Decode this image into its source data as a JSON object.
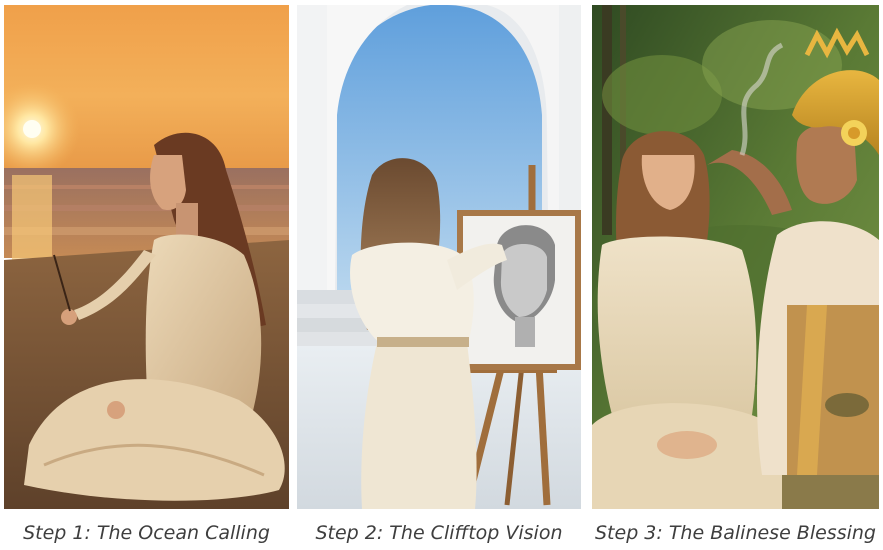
{
  "panels": [
    {
      "caption": "Step 1: The Ocean Calling"
    },
    {
      "caption": "Step 2: The Clifftop Vision"
    },
    {
      "caption": "Step 3: The Balinese Blessing"
    }
  ]
}
